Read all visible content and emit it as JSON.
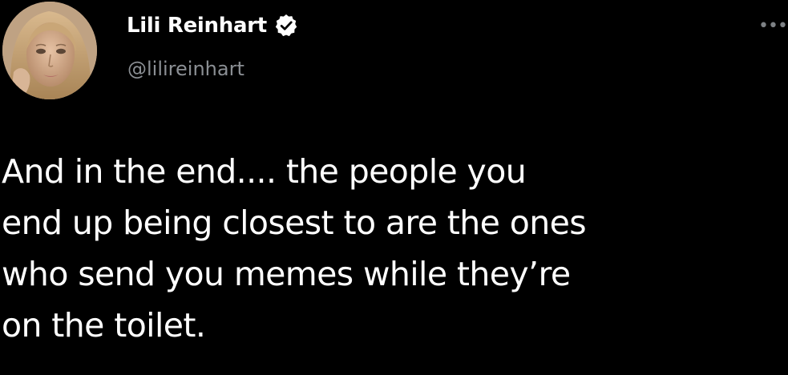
{
  "author": {
    "display_name": "Lili Reinhart",
    "handle": "@lilireinhart",
    "avatar_icon": "profile-photo",
    "verified_icon": "verified-badge-icon"
  },
  "menu": {
    "more_icon": "more-options-icon",
    "more_glyph": "•••"
  },
  "tweet": {
    "text": "And in the end.... the people you\nend up being closest to are the ones\nwho send you memes while they’re\non the toilet."
  },
  "colors": {
    "background": "#000000",
    "text": "#ffffff",
    "handle": "#8b8f94",
    "verified_fill": "#ffffff",
    "verified_check": "#000000"
  }
}
